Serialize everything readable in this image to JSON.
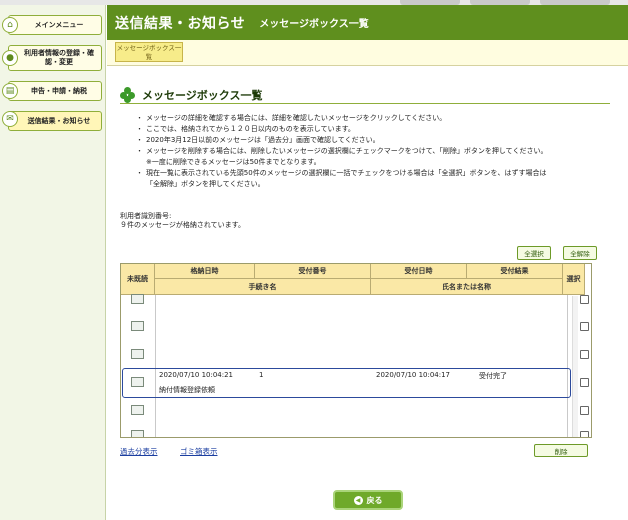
{
  "sidebar": {
    "items": [
      {
        "label": "メインメニュー",
        "icon": "home-icon"
      },
      {
        "label": "利用者情報の登録・確認・変更",
        "icon": "user-icon"
      },
      {
        "label": "申告・申請・納税",
        "icon": "document-icon"
      },
      {
        "label": "送信結果・お知らせ",
        "icon": "mail-icon"
      }
    ]
  },
  "header": {
    "title": "送信結果・お知らせ",
    "subtitle": "メッセージボックス一覧"
  },
  "breadcrumb": {
    "label": "メッセージボックス一覧"
  },
  "section": {
    "title": "メッセージボックス一覧",
    "notes": [
      "メッセージの詳細を確認する場合には、詳細を確認したいメッセージをクリックしてください。",
      "ここでは、格納されてから１２０日以内のものを表示しています。",
      "2020年3月12日以前のメッセージは「過去分」画面で確認してください。",
      "メッセージを削除する場合には、削除したいメッセージの選択欄にチェックマークをつけて、「削除」ボタンを押してください。",
      "※一度に削除できるメッセージは50件までとなります。",
      "現在一覧に表示されている先頭50件のメッセージの選択欄に一括でチェックをつける場合は「全選択」ボタンを、はずす場合は",
      "「全解除」ボタンを押してください。"
    ],
    "user_id_label": "利用者識別番号:",
    "message_count": "９件のメッセージが格納されています。"
  },
  "buttons": {
    "select_all": "全選択",
    "deselect_all": "全解除",
    "delete": "削除",
    "back": "戻る"
  },
  "table": {
    "headers": {
      "unread": "未既読",
      "stored_datetime": "格納日時",
      "receipt_number": "受付番号",
      "receipt_datetime": "受付日時",
      "receipt_result": "受付結果",
      "procedure_name": "手続き名",
      "name": "氏名または名称",
      "select": "選択"
    },
    "highlight_row": {
      "stored_datetime": "2020/07/10 10:04:21",
      "receipt_number": "1",
      "receipt_datetime": "2020/07/10 10:04:17",
      "receipt_result": "受付完了",
      "procedure_name": "納付情報登録依頼"
    }
  },
  "links": {
    "past": "過去分表示",
    "trash": "ゴミ箱表示"
  },
  "colors": {
    "header_green": "#5f8f1e",
    "table_header": "#fae8a6",
    "highlight_border": "#2c4a9c"
  }
}
